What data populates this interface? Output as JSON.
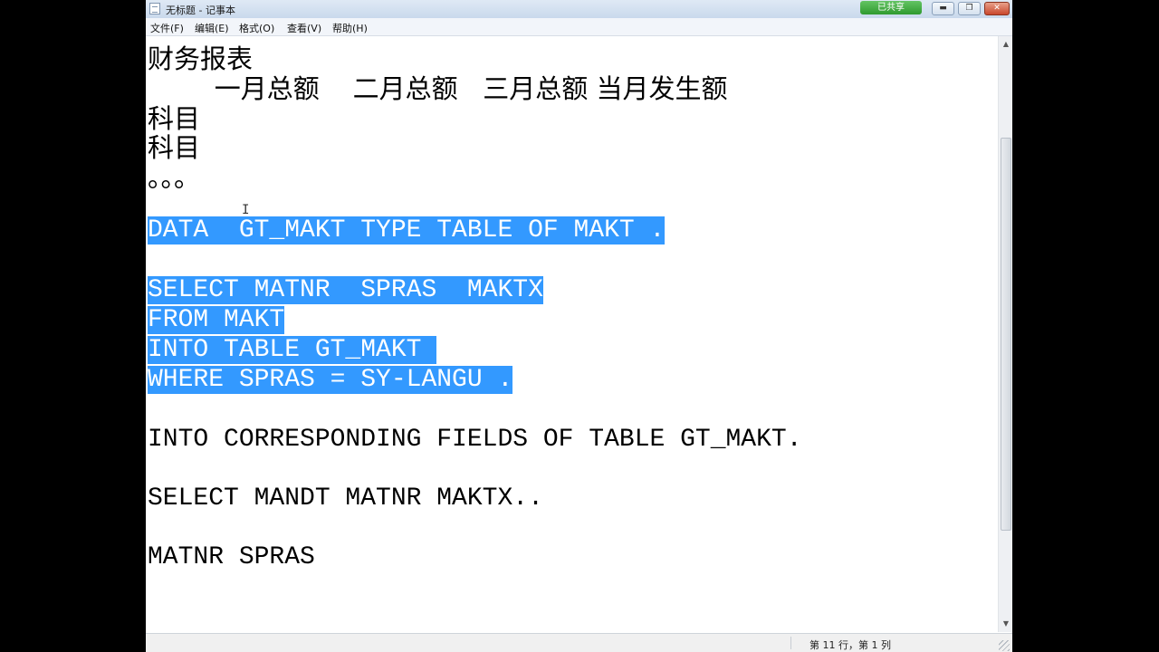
{
  "window": {
    "title": "无标题 - 记事本",
    "share_badge": "已共享",
    "minimize_icon": "minimize-icon",
    "maximize_icon": "restore-icon",
    "close_icon": "close-icon",
    "minimize_glyph": "▬",
    "maximize_glyph": "❐",
    "close_glyph": "✕"
  },
  "menu": {
    "items": [
      "文件(F)",
      "编辑(E)",
      "格式(O)",
      "查看(V)",
      "帮助(H)"
    ]
  },
  "editor": {
    "lines": [
      "财务报表",
      "        一月总额    二月总额   三月总额 当月发生额",
      "科目",
      "科目",
      "。。。",
      "DATA  GT_MAKT TYPE TABLE OF MAKT .",
      "SELECT MATNR  SPRAS  MAKTX",
      "FROM MAKT",
      "INTO TABLE GT_MAKT ",
      "WHERE SPRAS = SY-LANGU .",
      "INTO CORRESPONDING FIELDS OF TABLE GT_MAKT.",
      "SELECT MANDT MATNR MAKTX..",
      "MATNR SPRAS"
    ],
    "cursor_glyph": "I"
  },
  "statusbar": {
    "position": "第 11 行，第 1 列"
  },
  "scrollbar": {
    "up_glyph": "▲",
    "down_glyph": "▼"
  },
  "colors": {
    "selection": "#3399ff",
    "titlebar": "#dfe9f5",
    "close_button": "#c9472c"
  }
}
